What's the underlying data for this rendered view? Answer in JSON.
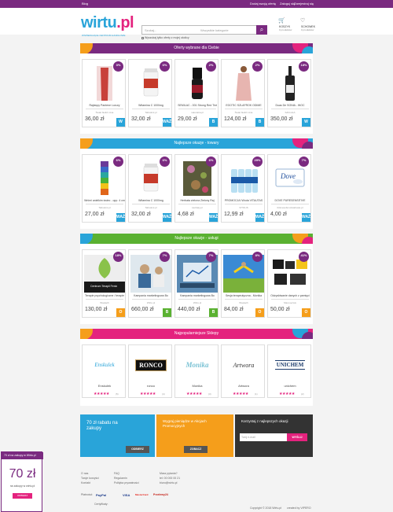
{
  "topbar": {
    "left": "Blog",
    "links": [
      "Dodaj swoją ofertę",
      "Zaloguj się",
      "Zarejestruj się"
    ]
  },
  "header": {
    "logo_a": "wirtu",
    "logo_b": ".pl",
    "tagline": "WSPIERAJĄCE CENTRUM HANDLOWE",
    "search_placeholder": "Szukaj...",
    "search_category": "Wszystkie kategorie",
    "checkbox_label": "Wyszukaj tylko oferty z mojej okolicy",
    "cart_label": "KOSZYK",
    "cart_sub": "0 produktów",
    "fav_label": "SCHOWEK",
    "fav_sub": "0 produktów"
  },
  "sections": [
    {
      "title": "Oferty wybrane dla Ciebie",
      "color": "#7a2a80",
      "items": [
        {
          "discount": "3%",
          "name": "Rajstopy Pantene Luxury",
          "shop": "Świat bielizn Ana",
          "price": "36,00 zł",
          "tag": "W",
          "tag_color": "#29a4d9"
        },
        {
          "discount": "6%",
          "name": "Witamina C 1000mg",
          "shop": "Tabsolmi.pl",
          "price": "32,00 zł",
          "tag": "WAŻ",
          "tag_color": "#29a4d9"
        },
        {
          "discount": "2%",
          "name": "SEMILAC - 001 Strong Red Tint",
          "shop": "naturalna.pl",
          "price": "29,00 zł",
          "tag": "B",
          "tag_color": "#29a4d9"
        },
        {
          "discount": "2%",
          "name": "EGOTIC SZLAFROK ODIME",
          "shop": "Świat bielizn Ana",
          "price": "124,00 zł",
          "tag": "B",
          "tag_color": "#29a4d9"
        },
        {
          "discount": "18%",
          "name": "Duas De SONIA - WOC",
          "shop": "SAN-HLA",
          "price": "350,00 zł",
          "tag": "W",
          "tag_color": "#29a4d9"
        }
      ]
    },
    {
      "title": "Najlepsze okazje - towary",
      "color": "#29a4d9",
      "items": [
        {
          "discount": "6%",
          "name": "Wnimi anielkim świec - opp. 4 cm",
          "shop": "Tabsolmi.pl",
          "price": "27,00 zł",
          "tag": "WAŻ",
          "tag_color": "#29a4d9"
        },
        {
          "discount": "6%",
          "name": "Witamina C 1000mg",
          "shop": "Tabsolmi.pl",
          "price": "32,00 zł",
          "tag": "WAŻ",
          "tag_color": "#29a4d9"
        },
        {
          "discount": "6%",
          "name": "Herbata zielona Zielony Raj",
          "shop": "Herbaty.pl",
          "price": "4,68 zł",
          "tag": "WAŻ",
          "tag_color": "#29a4d9"
        },
        {
          "discount": "29%",
          "name": "PROMOCJA! Woda VITAUTAS",
          "shop": "VITOLIS",
          "price": "12,99 zł",
          "tag": "WAŻ",
          "tag_color": "#29a4d9"
        },
        {
          "discount": "7%",
          "name": "DOVE PURESENSITIVE",
          "shop": "tbtimesubmuzstabosle.pl",
          "price": "4,00 zł",
          "tag": "WAŻ",
          "tag_color": "#29a4d9"
        }
      ]
    },
    {
      "title": "Najlepsze okazje - usługi",
      "color": "#5ab131",
      "items": [
        {
          "discount": "18%",
          "name": "Terapie psychologiczne / terapie",
          "shop": "Wsqiach",
          "price": "130,00 zł",
          "tag": "O",
          "tag_color": "#f59e1b",
          "caption": "Centrum Terapii Fenix"
        },
        {
          "discount": "7%",
          "name": "Kampania marketingowa Bo",
          "shop": "Wirtu.pl",
          "price": "660,00 zł",
          "tag": "B",
          "tag_color": "#5ab131"
        },
        {
          "discount": "7%",
          "name": "Kampania marketingowa Bo",
          "shop": "Wirtu.pl",
          "price": "440,00 zł",
          "tag": "B",
          "tag_color": "#5ab131"
        },
        {
          "discount": "8%",
          "name": "Sesja terapeutyczna - Monika",
          "shop": "Wsqiach",
          "price": "84,00 zł",
          "tag": "O",
          "tag_color": "#f59e1b"
        },
        {
          "discount": "41%",
          "name": "Odzyskiwanie danych z pamięci",
          "shop": "Maxi-serwis",
          "price": "50,00 zł",
          "tag": "O",
          "tag_color": "#f59e1b"
        }
      ]
    }
  ],
  "shops": {
    "title": "Najpopularniejsze Sklepy",
    "color": "#e4237e",
    "items": [
      {
        "logo": "Enskulek",
        "name": "Enskulek",
        "count": "(5)"
      },
      {
        "logo": "RONCO",
        "name": "ronco",
        "count": "(4)"
      },
      {
        "logo": "Monika",
        "name": "Monika",
        "count": "(3)"
      },
      {
        "logo": "Artwora",
        "name": "Artwora",
        "count": "(1)"
      },
      {
        "logo": "UNICHEM",
        "name": "unichem",
        "count": "(2)"
      }
    ]
  },
  "promos": [
    {
      "title": "70 zł rabatu na zakupy",
      "button": "ODBIERZ",
      "color": "#29a4d9"
    },
    {
      "title": "Wygraj pieniądze w Akcjach Promocyjnych",
      "button": "ZOBACZ",
      "color": "#f59e1b"
    },
    {
      "title": "Korzystaj z najlepszych okazji",
      "button": "WYŚLIJ",
      "placeholder": "Twój e-mail",
      "color": "#333333"
    }
  ],
  "footer": {
    "col1": [
      "O nas",
      "Twoje korzyści",
      "Kontakt"
    ],
    "col2": [
      "FAQ",
      "Regulamin",
      "Polityka prywatności"
    ],
    "col3": [
      "Masz pytania?",
      "tel: 00 000 00 21",
      "biuro@wirtu.pl"
    ],
    "payments_label": "Płatności:",
    "partners_label": "Certyfikaty:",
    "payments": [
      "PayPal",
      "VISA",
      "MasterCard",
      "Przelewy24"
    ],
    "copyright": "Copyright © 2018 Wirtu.pl",
    "made_by": "created by VIPERO"
  },
  "popup": {
    "header": "70 zł na zakupy w Wirtu.pl",
    "amount": "70 zł",
    "sub": "na zakupy w wirtu.pl",
    "button": "ODBIERZ"
  }
}
